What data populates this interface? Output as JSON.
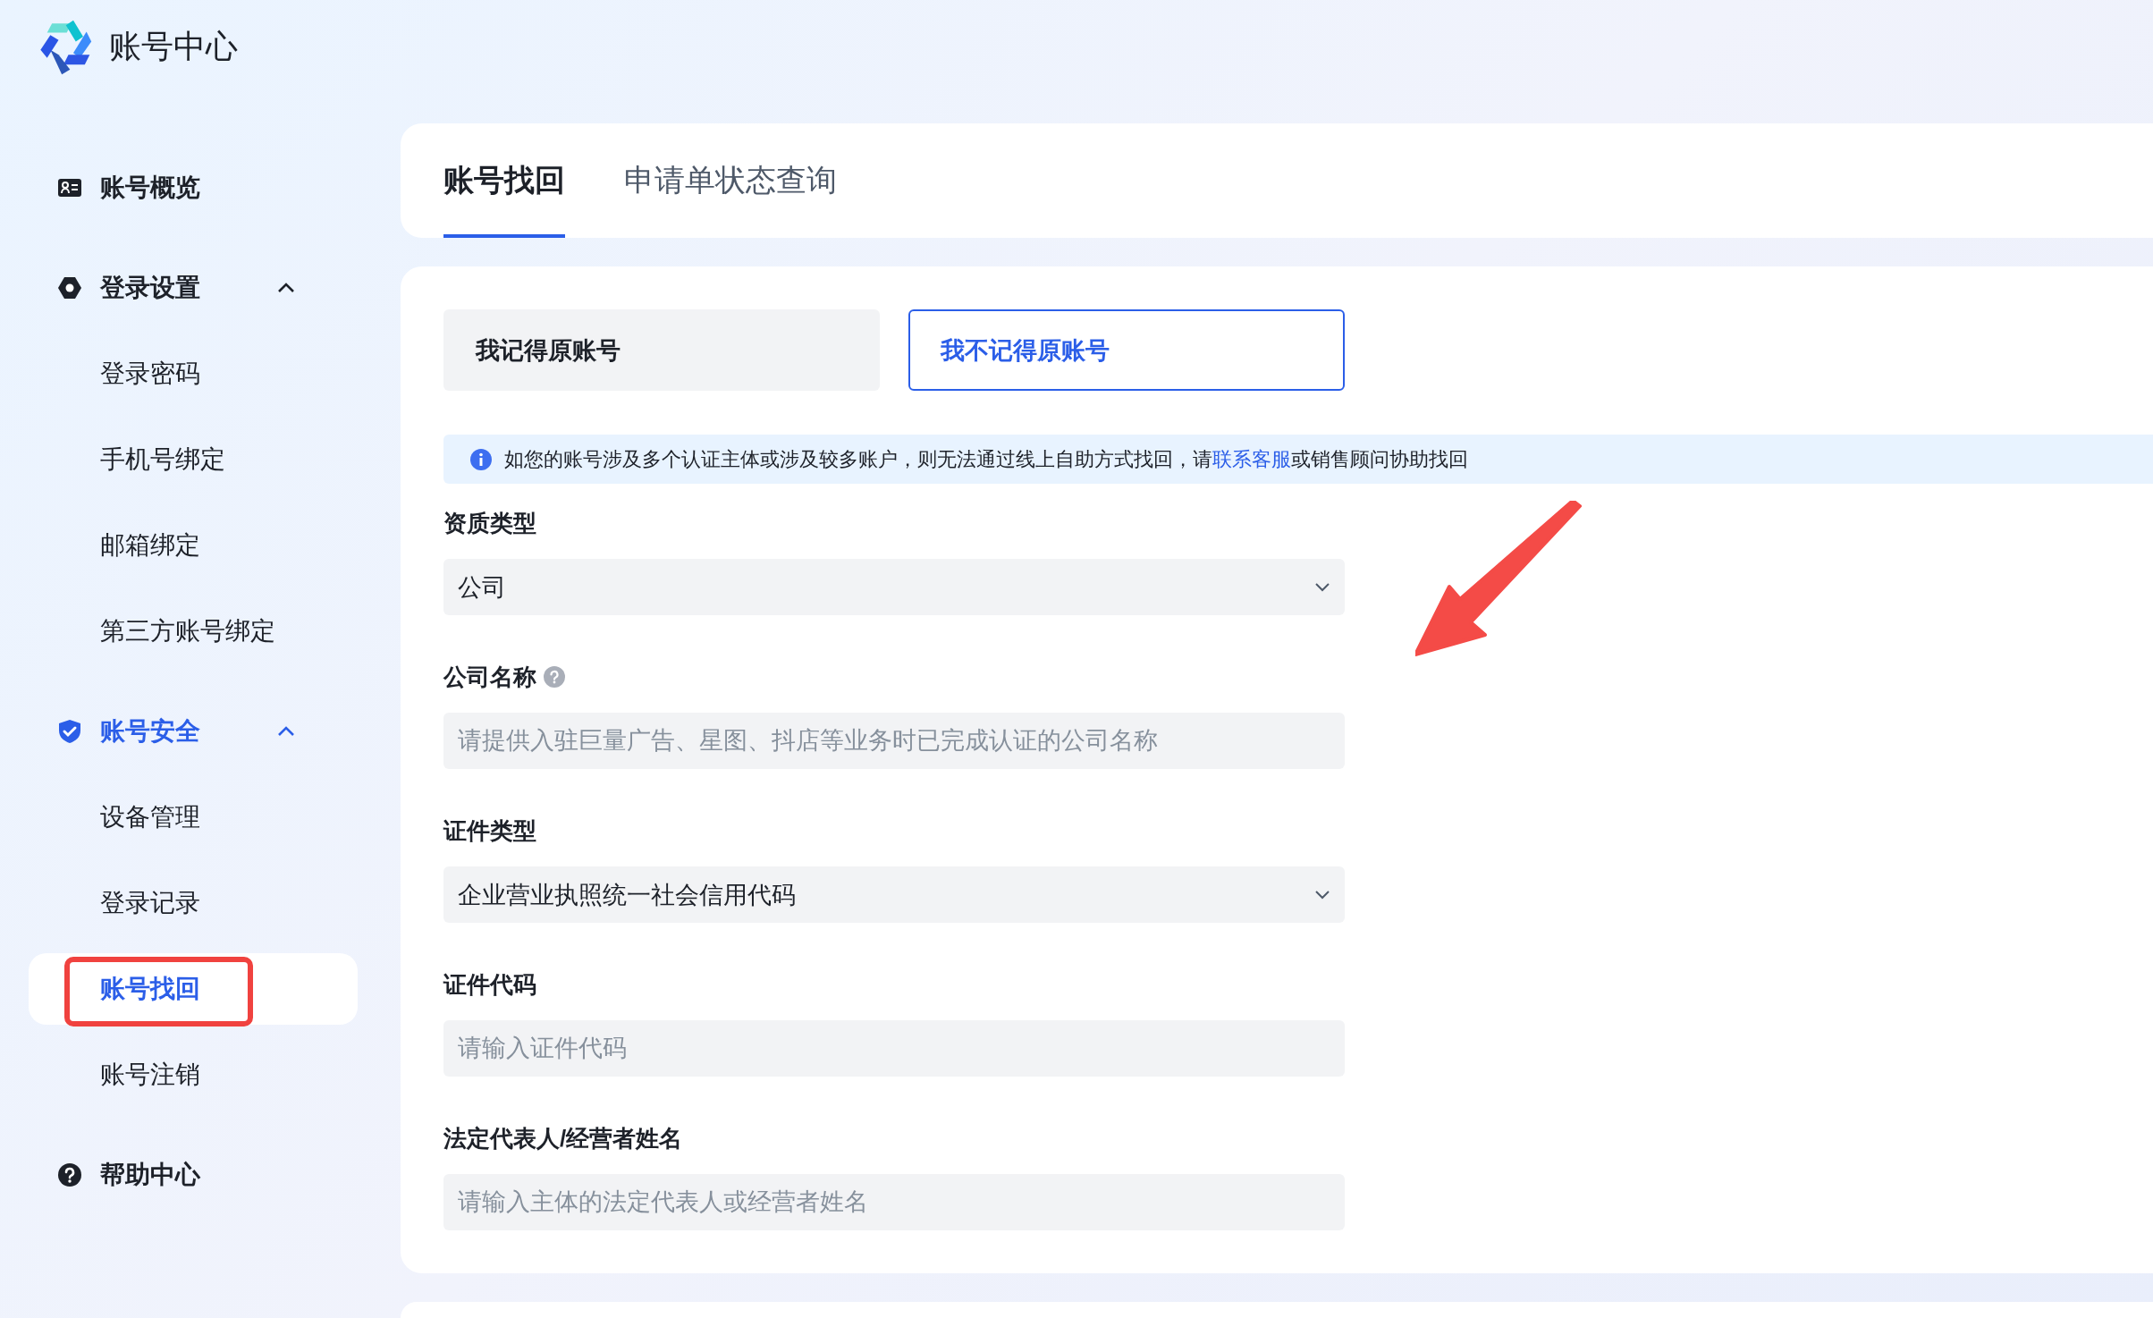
{
  "app": {
    "title": "账号中心"
  },
  "sidebar": {
    "items": [
      {
        "label": "账号概览",
        "active": false
      },
      {
        "label": "登录设置",
        "active": false,
        "expanded": true,
        "children": [
          {
            "label": "登录密码",
            "selected": false
          },
          {
            "label": "手机号绑定",
            "selected": false
          },
          {
            "label": "邮箱绑定",
            "selected": false
          },
          {
            "label": "第三方账号绑定",
            "selected": false
          }
        ]
      },
      {
        "label": "账号安全",
        "active": true,
        "expanded": true,
        "children": [
          {
            "label": "设备管理",
            "selected": false
          },
          {
            "label": "登录记录",
            "selected": false
          },
          {
            "label": "账号找回",
            "selected": true,
            "circled": true
          },
          {
            "label": "账号注销",
            "selected": false
          }
        ]
      },
      {
        "label": "帮助中心",
        "active": false
      }
    ]
  },
  "tabs": [
    {
      "label": "账号找回",
      "selected": true
    },
    {
      "label": "申请单状态查询",
      "selected": false
    }
  ],
  "recovery_options": [
    {
      "label": "我记得原账号",
      "selected": false
    },
    {
      "label": "我不记得原账号",
      "selected": true
    }
  ],
  "notice": {
    "text_before": "如您的账号涉及多个认证主体或涉及较多账户，则无法通过线上自助方式找回，请",
    "link": "联系客服",
    "text_after": "或销售顾问协助找回"
  },
  "form": {
    "fields": [
      {
        "label": "资质类型",
        "kind": "select",
        "value": "公司"
      },
      {
        "label": "公司名称",
        "kind": "input",
        "placeholder": "请提供入驻巨量广告、星图、抖店等业务时已完成认证的公司名称",
        "help": true
      },
      {
        "label": "证件类型",
        "kind": "select",
        "value": "企业营业执照统一社会信用代码"
      },
      {
        "label": "证件代码",
        "kind": "input",
        "placeholder": "请输入证件代码"
      },
      {
        "label": "法定代表人/经营者姓名",
        "kind": "input",
        "placeholder": "请输入主体的法定代表人或经营者姓名"
      }
    ]
  },
  "annotations": [
    {
      "kind": "arrow"
    }
  ]
}
